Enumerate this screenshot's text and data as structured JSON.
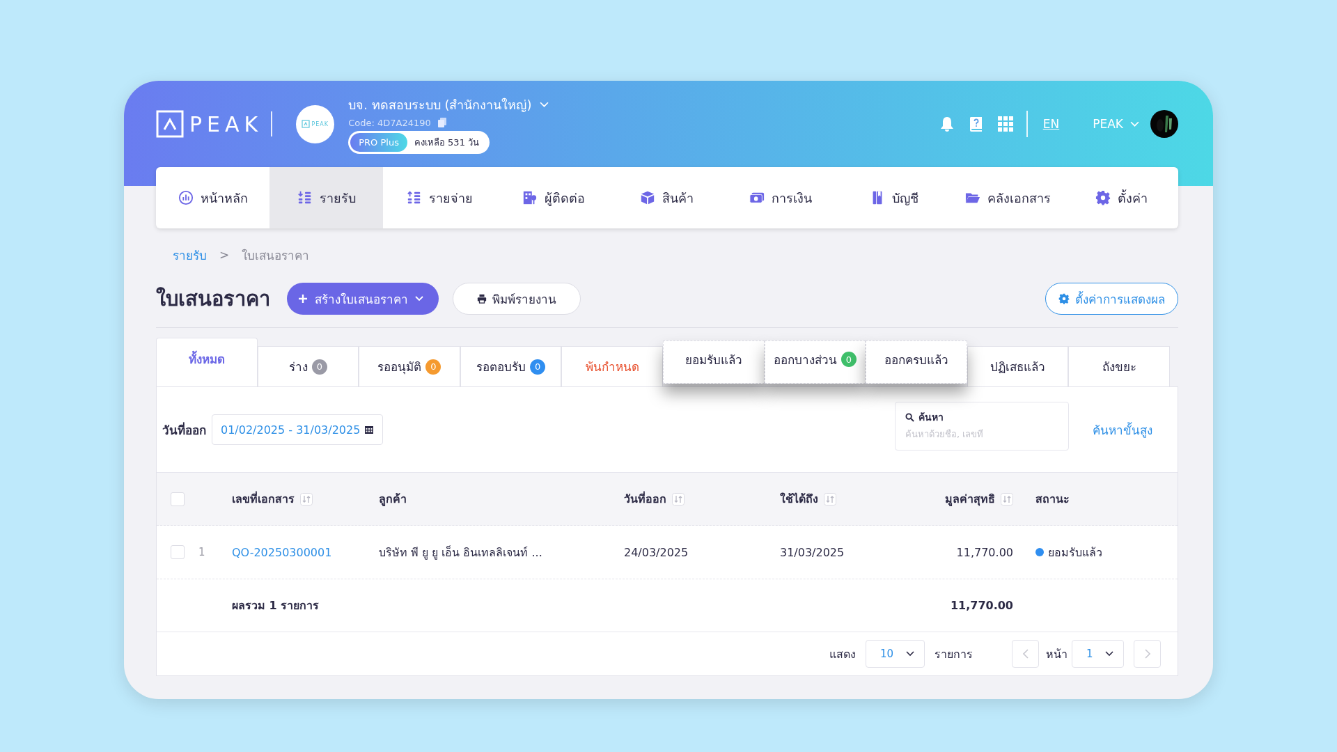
{
  "header": {
    "logo": "PEAK",
    "company_logo": "PEAK",
    "company_name": "บจ. ทดสอบระบบ (สำนักงานใหญ่)",
    "code": "Code: 4D7A24190",
    "plan": "PRO Plus",
    "remaining": "คงเหลือ 531 วัน",
    "language": "EN",
    "user": "PEAK"
  },
  "nav": [
    {
      "label": "หน้าหลัก",
      "kind": "dashboard",
      "selected": false
    },
    {
      "label": "รายรับ",
      "kind": "income",
      "selected": true
    },
    {
      "label": "รายจ่าย",
      "kind": "expense",
      "selected": false
    },
    {
      "label": "ผู้ติดต่อ",
      "kind": "contacts",
      "selected": false
    },
    {
      "label": "สินค้า",
      "kind": "products",
      "selected": false
    },
    {
      "label": "การเงิน",
      "kind": "finance",
      "selected": false
    },
    {
      "label": "บัญชี",
      "kind": "accounts",
      "selected": false
    },
    {
      "label": "คลังเอกสาร",
      "kind": "documents",
      "selected": false
    },
    {
      "label": "ตั้งค่า",
      "kind": "settings",
      "selected": false
    }
  ],
  "breadcrumb": {
    "parent": "รายรับ",
    "separator": ">",
    "current": "ใบเสนอราคา"
  },
  "page_title": "ใบเสนอราคา",
  "create_button": "สร้างใบเสนอราคา",
  "print_button": "พิมพ์รายงาน",
  "display_settings_button": "ตั้งค่าการแสดงผล",
  "tabs": [
    {
      "label": "ทั้งหมด",
      "selected": true,
      "raised": false,
      "alert": false
    },
    {
      "label": "ร่าง",
      "count": "0",
      "color": "#9a9aa6",
      "selected": false,
      "raised": false,
      "alert": false
    },
    {
      "label": "รออนุมัติ",
      "count": "0",
      "color": "#f59a2f",
      "selected": false,
      "raised": false,
      "alert": false
    },
    {
      "label": "รอตอบรับ",
      "count": "0",
      "color": "#2f8ef0",
      "selected": false,
      "raised": false,
      "alert": false
    },
    {
      "label": "พ้นกำหนด",
      "selected": false,
      "raised": false,
      "alert": true
    },
    {
      "label": "ยอมรับแล้ว",
      "selected": false,
      "raised": true,
      "alert": false
    },
    {
      "label": "ออกบางส่วน",
      "count": "0",
      "color": "#3fbf6a",
      "selected": false,
      "raised": true,
      "alert": false
    },
    {
      "label": "ออกครบแล้ว",
      "selected": false,
      "raised": true,
      "alert": false
    },
    {
      "label": "ปฏิเสธแล้ว",
      "selected": false,
      "raised": false,
      "alert": false
    },
    {
      "label": "ถังขยะ",
      "selected": false,
      "raised": false,
      "alert": false
    }
  ],
  "filter": {
    "date_label": "วันที่ออก",
    "date_range": "01/02/2025 - 31/03/2025",
    "search_label": "ค้นหา",
    "search_placeholder": "ค้นหาด้วยชื่อ, เลขที่",
    "advanced_search": "ค้นหาขั้นสูง"
  },
  "table": {
    "select_all_checked": false,
    "columns": [
      {
        "label": "เลขที่เอกสาร",
        "sortable": true
      },
      {
        "label": "ลูกค้า",
        "sortable": false
      },
      {
        "label": "วันที่ออก",
        "sortable": true
      },
      {
        "label": "ใช้ได้ถึง",
        "sortable": true
      },
      {
        "label": "มูลค่าสุทธิ",
        "sortable": true
      },
      {
        "label": "สถานะ",
        "sortable": false
      }
    ],
    "rows": [
      {
        "checked": false,
        "index": "1",
        "cells": [
          "QO-20250300001",
          "บริษัท พี ยู ยู เอ็น อินเทลลิเจนท์ ...",
          "24/03/2025",
          "31/03/2025",
          "11,770.00",
          "ยอมรับแล้ว"
        ],
        "color": "#2f8ef0"
      }
    ],
    "total_label": "ผลรวม 1 รายการ",
    "total_value": "11,770.00"
  },
  "pagination": {
    "show_label": "แสดง",
    "page_size": "10",
    "items_label": "รายการ",
    "page_label": "หน้า",
    "page": "1"
  }
}
